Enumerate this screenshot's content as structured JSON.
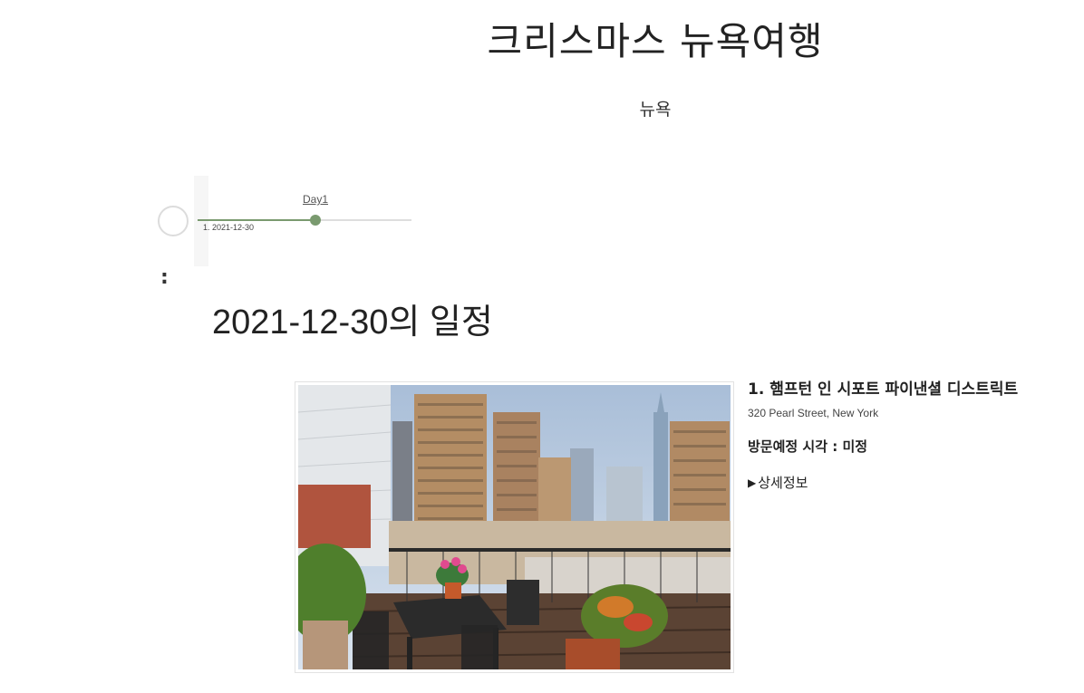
{
  "trip": {
    "title": "크리스마스 뉴욕여행",
    "city": "뉴욕"
  },
  "timeline": {
    "day_label": "Day1",
    "day_date": "1. 2021-12-30",
    "progress": 0.55,
    "colors": {
      "track": "#dedede",
      "active": "#7a9a6f"
    }
  },
  "separator": ":",
  "schedule": {
    "heading": "2021-12-30의 일정",
    "places": [
      {
        "name": "1. 햄프턴 인 시포트 파이낸셜 디스트릭트",
        "address": "320 Pearl Street, New York",
        "visit_time": "방문예정 시각 : 미정",
        "details_label": "상세정보",
        "details_icon": "triangle-right-icon"
      }
    ]
  }
}
